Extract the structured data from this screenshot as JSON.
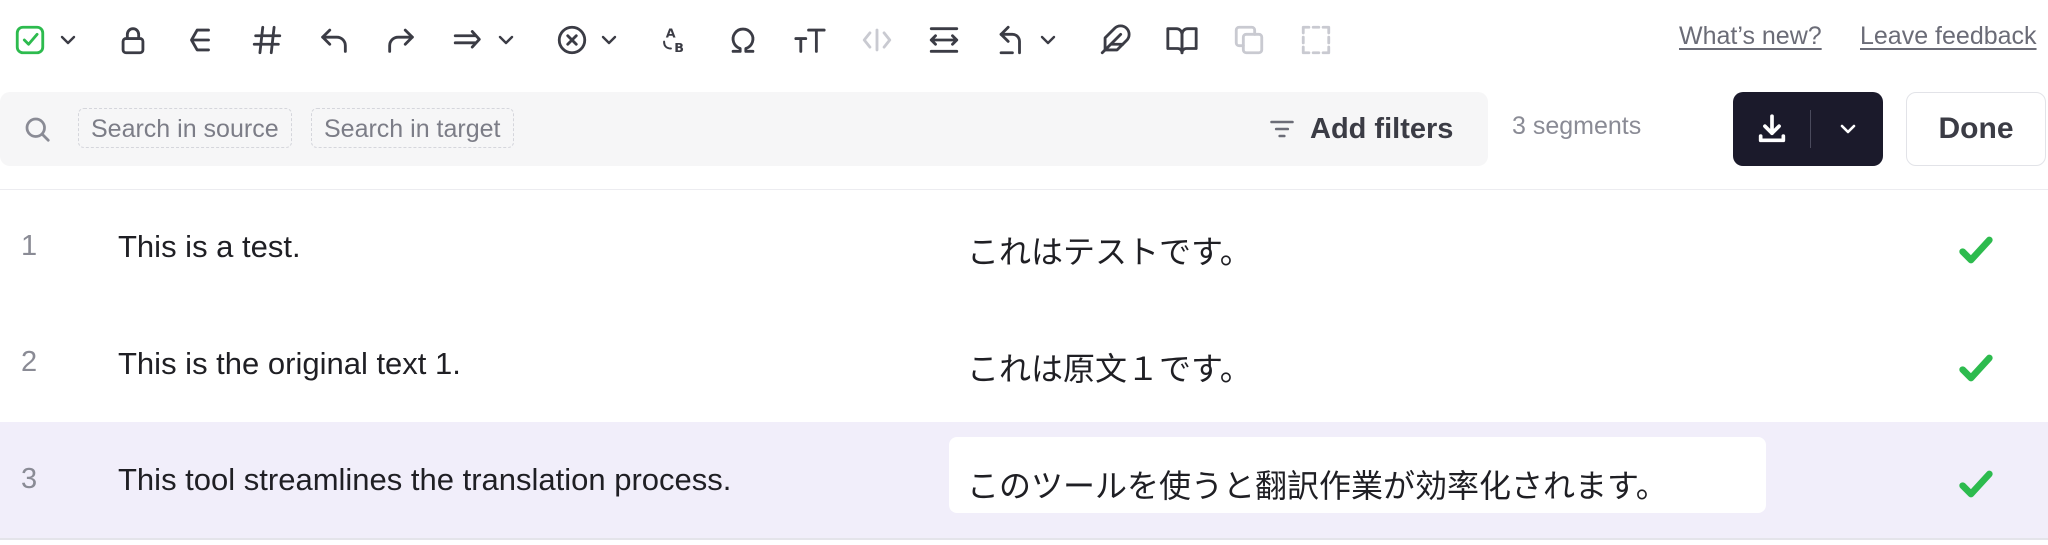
{
  "toolbar": {
    "icons": [
      "confirm-check-icon",
      "lock-icon",
      "join-icon",
      "hash-icon",
      "undo-icon",
      "redo-icon",
      "copy-source-icon",
      "clear-icon",
      "case-icon",
      "omega-icon",
      "text-size-icon",
      "tags-icon",
      "wrap-icon",
      "revert-icon",
      "feather-icon",
      "book-icon",
      "duplicate-icon",
      "split-icon"
    ],
    "case_glyph_top": "A",
    "case_glyph_bottom": "B",
    "whats_new": "What’s new?",
    "feedback": "Leave feedback"
  },
  "search": {
    "source_placeholder": "Search in source",
    "target_placeholder": "Search in target",
    "filters_label": "Add filters"
  },
  "segment_count": "3 segments",
  "done_label": "Done",
  "colors": {
    "accent_dark": "#1b1a2b",
    "confirm_green": "#2dbb4e",
    "active_row": "#f1eefa"
  },
  "segments": [
    {
      "num": "1",
      "source": "This is a test.",
      "target": "これはテストです。",
      "confirmed": true
    },
    {
      "num": "2",
      "source": "This is the original text 1.",
      "target": "これは原文１です。",
      "confirmed": true
    },
    {
      "num": "3",
      "source": "This tool streamlines the translation process.",
      "target": "このツールを使うと翻訳作業が効率化されます。",
      "confirmed": true,
      "active": true
    }
  ]
}
